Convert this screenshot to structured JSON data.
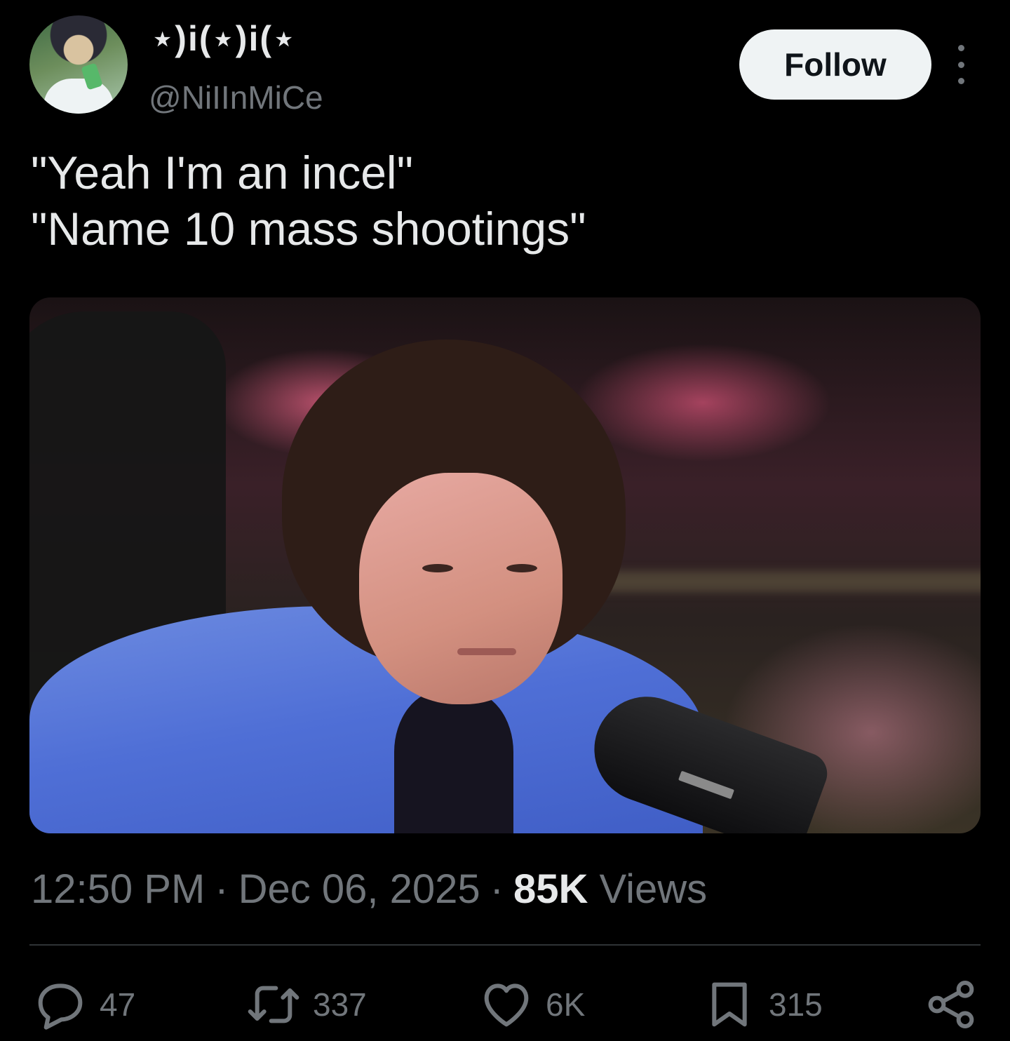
{
  "author": {
    "display_name": "⋆)i(⋆)i(⋆",
    "handle": "@NiIInMiCe",
    "avatar_icon": "anime-avatar"
  },
  "follow_label": "Follow",
  "more_icon": "more-vertical-icon",
  "tweet": {
    "text": "\"Yeah I'm an incel\"\n\"Name 10 mass shootings\""
  },
  "meta": {
    "time": "12:50 PM",
    "date": "Dec 06, 2025",
    "views_count": "85K",
    "views_label": "Views"
  },
  "actions": {
    "replies": "47",
    "retweets": "337",
    "likes": "6K",
    "bookmarks": "315"
  },
  "colors": {
    "background": "#000000",
    "text_primary": "#e7e9ea",
    "text_secondary": "#71767b",
    "follow_bg": "#eff3f4",
    "divider": "#2f3336"
  }
}
